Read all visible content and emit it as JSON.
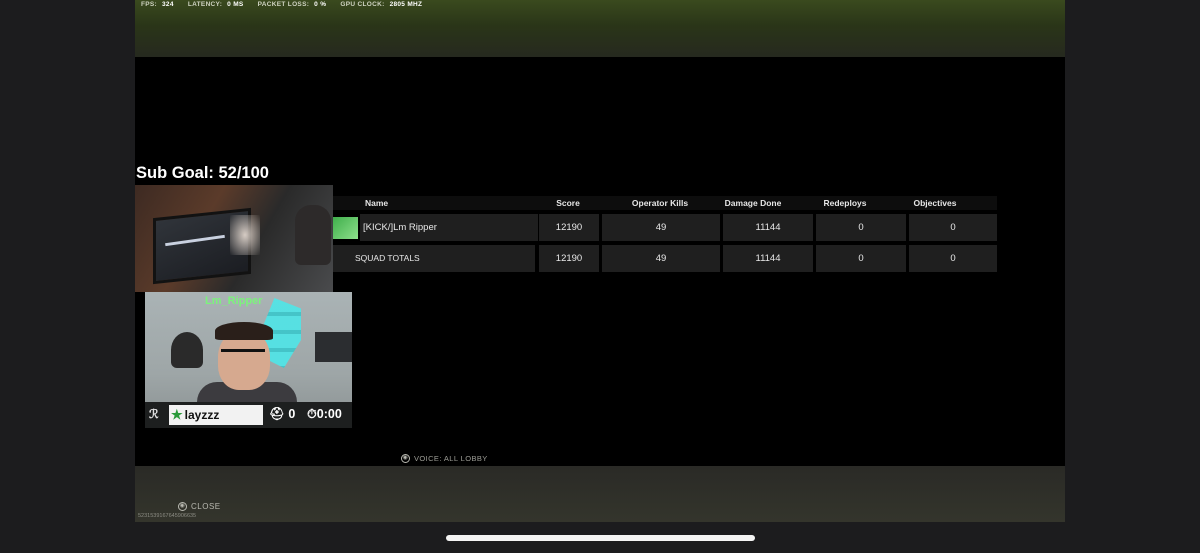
{
  "top_stats": {
    "fps_label": "FPS:",
    "fps_value": "324",
    "latency_label": "LATENCY:",
    "latency_value": "0 MS",
    "packet_label": "PACKET LOSS:",
    "packet_value": "0 %",
    "gpu_label": "GPU CLOCK:",
    "gpu_value": "2805 MHZ"
  },
  "sub_goal": "Sub Goal: 52/100",
  "scoreboard": {
    "headers": [
      "Name",
      "Score",
      "Operator Kills",
      "Damage Done",
      "Redeploys",
      "Objectives"
    ],
    "rows": [
      {
        "name": "[KICK/]Lm Ripper",
        "score": "12190",
        "kills": "49",
        "damage": "11144",
        "redeploys": "0",
        "objectives": "0"
      },
      {
        "name": "SQUAD TOTALS",
        "score": "12190",
        "kills": "49",
        "damage": "11144",
        "redeploys": "0",
        "objectives": "0"
      }
    ]
  },
  "voice": "VOICE: ALL LOBBY",
  "close_label": "CLOSE",
  "match_id": "5231539167645906635",
  "webcam": {
    "neon_sign": "Lm_Ripper",
    "gamertag": "layzzz",
    "hud_count": "0",
    "hud_timer": "0:00"
  },
  "colors": {
    "accent_green": "#3fae4b",
    "neon_cyan": "#4ee6e8"
  }
}
